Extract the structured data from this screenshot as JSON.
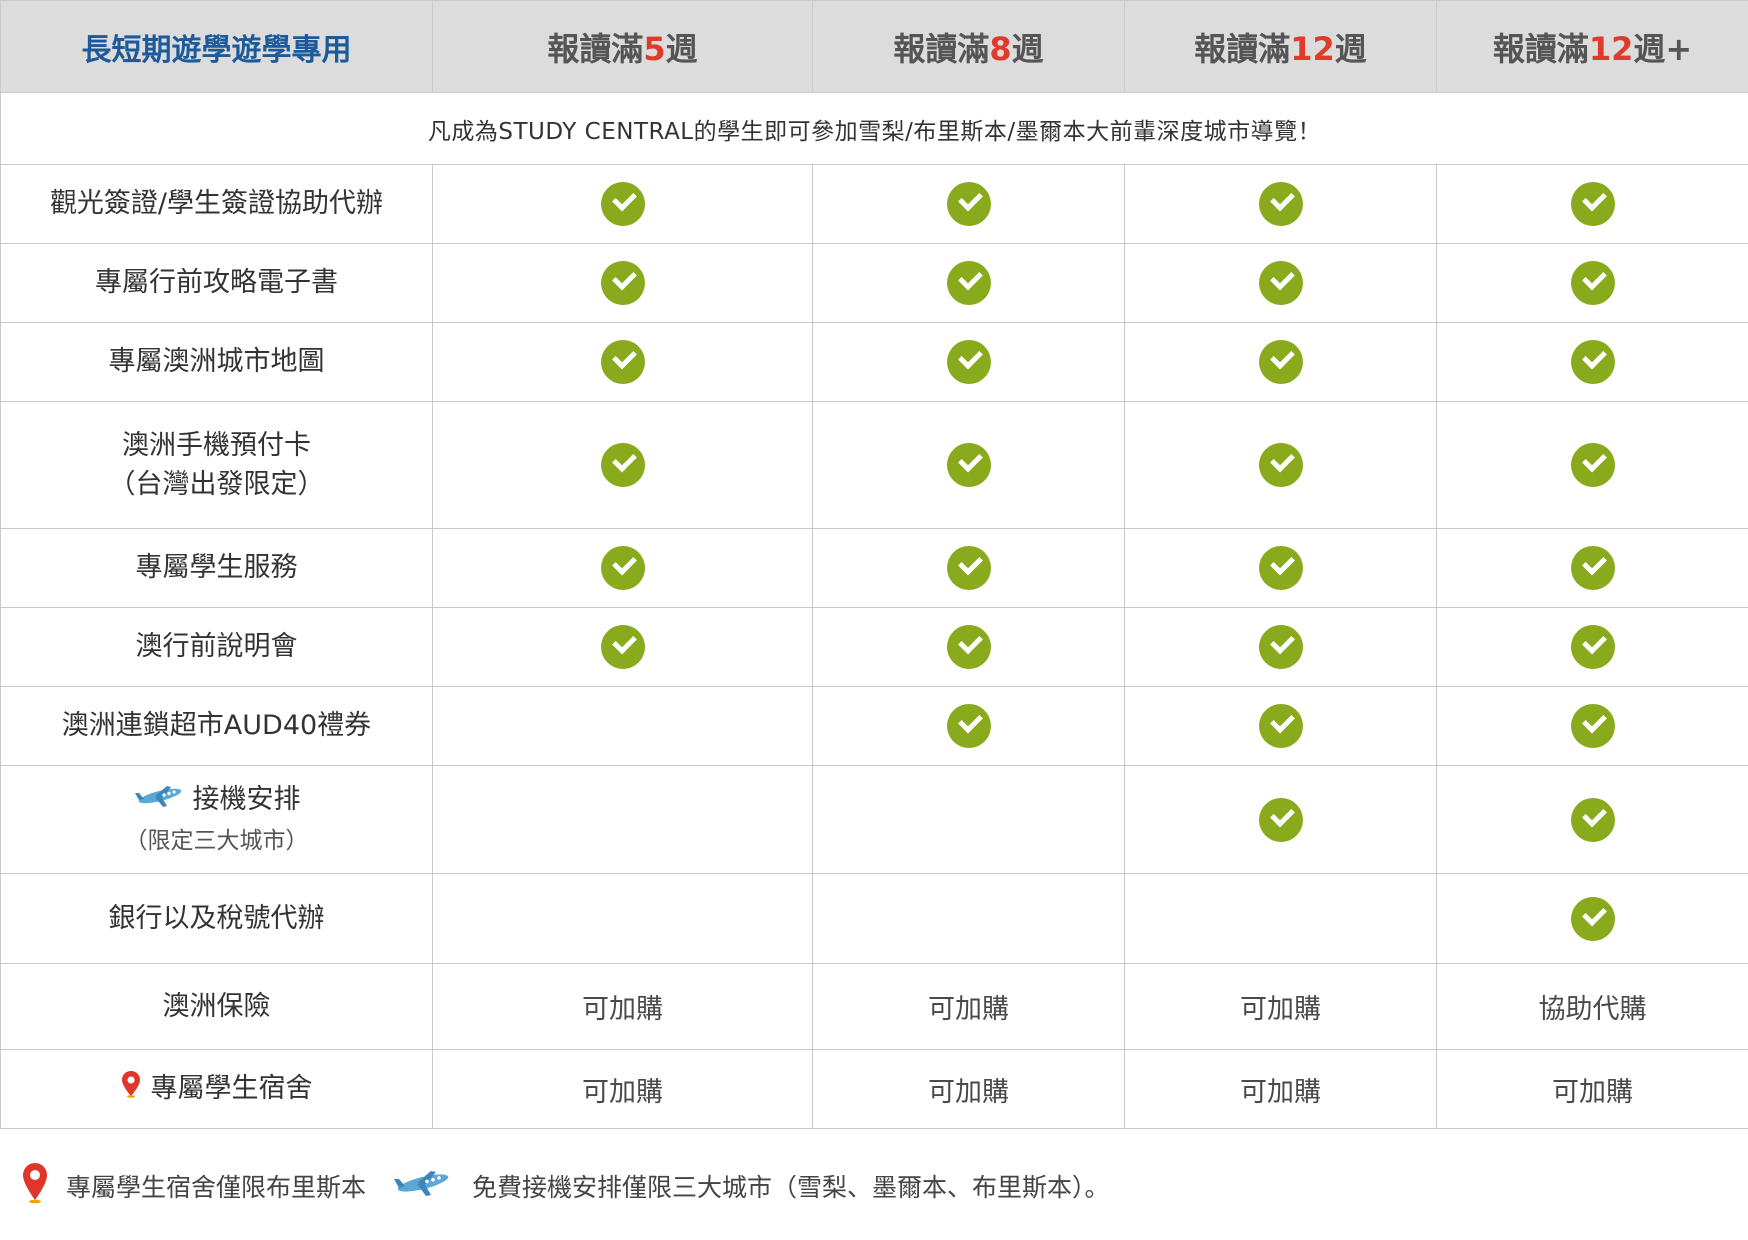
{
  "header": {
    "corner": "長短期遊學遊學專用",
    "columns": [
      {
        "prefix": "報讀滿",
        "num": "5",
        "suffix": "週"
      },
      {
        "prefix": "報讀滿",
        "num": "8",
        "suffix": "週"
      },
      {
        "prefix": "報讀滿",
        "num": "12",
        "suffix": "週"
      },
      {
        "prefix": "報讀滿",
        "num": "12",
        "suffix": "週+"
      }
    ]
  },
  "notice": "凡成為STUDY CENTRAL的學生即可參加雪梨/布里斯本/墨爾本大前輩深度城市導覽！",
  "rows": [
    {
      "label": "觀光簽證/學生簽證協助代辦"
    },
    {
      "label": "專屬行前攻略電子書"
    },
    {
      "label": "專屬澳洲城市地圖"
    },
    {
      "label": "澳洲手機預付卡",
      "sub": "（台灣出發限定）"
    },
    {
      "label": "專屬學生服務"
    },
    {
      "label": "澳行前說明會"
    },
    {
      "label": "澳洲連鎖超市AUD40禮券"
    },
    {
      "label": "接機安排",
      "sub": "（限定三大城市）",
      "icon": "airplane-icon"
    },
    {
      "label": "銀行以及稅號代辦"
    },
    {
      "label": "澳洲保險",
      "cells": [
        "可加購",
        "可加購",
        "可加購",
        "協助代購"
      ]
    },
    {
      "label": "專屬學生宿舍",
      "icon": "location-pin-icon",
      "cells": [
        "可加購",
        "可加購",
        "可加購",
        "可加購"
      ]
    }
  ],
  "checks": [
    [
      true,
      true,
      true,
      true
    ],
    [
      true,
      true,
      true,
      true
    ],
    [
      true,
      true,
      true,
      true
    ],
    [
      true,
      true,
      true,
      true
    ],
    [
      true,
      true,
      true,
      true
    ],
    [
      true,
      true,
      true,
      true
    ],
    [
      false,
      true,
      true,
      true
    ],
    [
      false,
      false,
      true,
      true
    ],
    [
      false,
      false,
      false,
      true
    ]
  ],
  "footer": {
    "pin_note": "專屬學生宿舍僅限布里斯本",
    "plane_note": "免費接機安排僅限三大城市（雪梨、墨爾本、布里斯本）。"
  },
  "colors": {
    "check": "#8aaa1e",
    "header_accent": "#e03a2a",
    "corner_text": "#1d5a9a",
    "header_bg": "#dcdcdc"
  }
}
